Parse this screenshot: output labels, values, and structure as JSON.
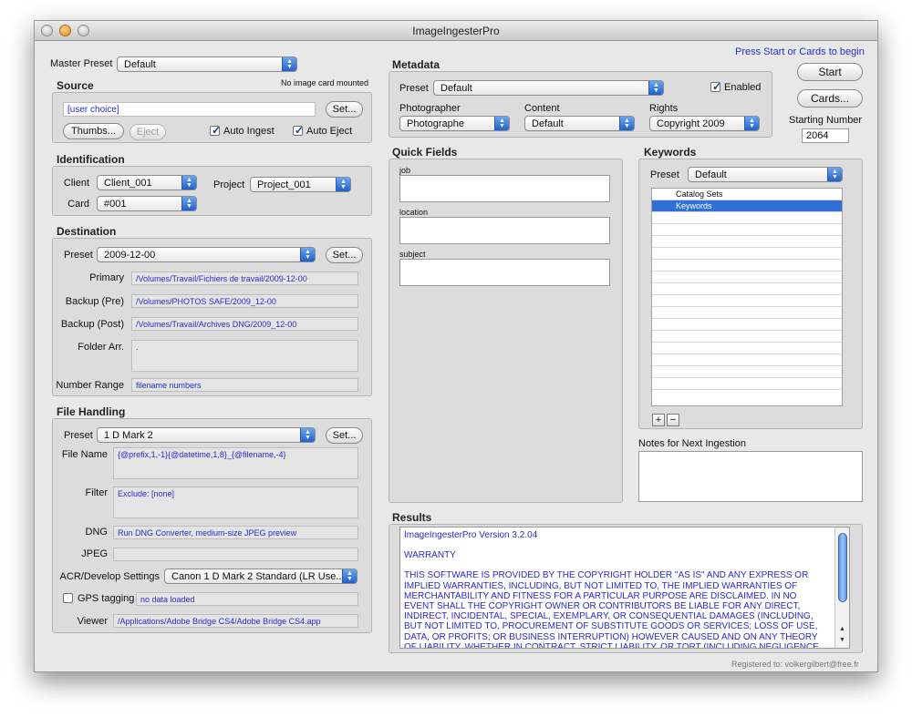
{
  "window": {
    "title": "ImageIngesterPro"
  },
  "master_preset": {
    "label": "Master Preset",
    "value": "Default"
  },
  "source": {
    "title": "Source",
    "status": "No image card mounted",
    "path": "[user choice]",
    "set_label": "Set...",
    "thumbs_label": "Thumbs...",
    "eject_label": "Eject",
    "auto_ingest": {
      "label": "Auto Ingest",
      "checked": true
    },
    "auto_eject": {
      "label": "Auto Eject",
      "checked": true
    }
  },
  "identification": {
    "title": "Identification",
    "client_label": "Client",
    "client_value": "Client_001",
    "project_label": "Project",
    "project_value": "Project_001",
    "card_label": "Card",
    "card_value": "#001"
  },
  "destination": {
    "title": "Destination",
    "preset_label": "Preset",
    "preset_value": "2009-12-00",
    "set_label": "Set...",
    "primary_label": "Primary",
    "primary_value": "/Volumes/Travail/Fichiers de travail/2009-12-00",
    "backup_pre_label": "Backup (Pre)",
    "backup_pre_value": "/Volumes/PHOTOS SAFE/2009_12-00",
    "backup_post_label": "Backup (Post)",
    "backup_post_value": "/Volumes/Travail/Archives DNG/2009_12-00",
    "folder_arr_label": "Folder Arr.",
    "folder_arr_value": ".",
    "number_range_label": "Number Range",
    "number_range_value": "filename numbers"
  },
  "file_handling": {
    "title": "File Handling",
    "preset_label": "Preset",
    "preset_value": "1 D Mark 2",
    "set_label": "Set...",
    "file_name_label": "File Name",
    "file_name_value": "{@prefix,1,-1}{@datetime,1,8}_{@filename,-4}",
    "filter_label": "Filter",
    "filter_value": "Exclude: [none]",
    "dng_label": "DNG",
    "dng_value": "Run DNG Converter, medium-size JPEG preview",
    "jpeg_label": "JPEG",
    "jpeg_value": "",
    "acr_label": "ACR/Develop Settings",
    "acr_value": "Canon 1 D Mark 2 Standard (LR Use...",
    "gps_label": "GPS tagging",
    "gps_checked": false,
    "gps_value": "no data loaded",
    "viewer_label": "Viewer",
    "viewer_value": "/Applications/Adobe Bridge CS4/Adobe Bridge CS4.app"
  },
  "prompt": "Press Start or Cards to begin",
  "metadata": {
    "title": "Metadata",
    "preset_label": "Preset",
    "preset_value": "Default",
    "enabled": {
      "label": "Enabled",
      "checked": true
    },
    "photographer_label": "Photographer",
    "photographer_value": "Photographe",
    "content_label": "Content",
    "content_value": "Default",
    "rights_label": "Rights",
    "rights_value": "Copyright 2009"
  },
  "controls": {
    "start_label": "Start",
    "cards_label": "Cards...",
    "starting_number_label": "Starting Number",
    "starting_number_value": "2064"
  },
  "quick_fields": {
    "title": "Quick Fields",
    "job_label": "job",
    "location_label": "location",
    "subject_label": "subject"
  },
  "keywords": {
    "title": "Keywords",
    "preset_label": "Preset",
    "preset_value": "Default",
    "items": [
      {
        "label": "Catalog Sets",
        "selected": false
      },
      {
        "label": "Keywords",
        "selected": true
      }
    ],
    "add_label": "+",
    "remove_label": "−"
  },
  "notes": {
    "label": "Notes for Next Ingestion"
  },
  "results": {
    "title": "Results",
    "version": "ImageIngesterPro Version 3.2.04",
    "warranty": "WARRANTY",
    "body": "THIS SOFTWARE IS PROVIDED BY THE COPYRIGHT HOLDER \"AS IS\" AND ANY EXPRESS OR IMPLIED WARRANTIES, INCLUDING, BUT NOT LIMITED TO, THE IMPLIED WARRANTIES OF MERCHANTABILITY AND FITNESS FOR A PARTICULAR PURPOSE ARE DISCLAIMED. IN NO EVENT SHALL THE COPYRIGHT OWNER OR CONTRIBUTORS BE LIABLE FOR ANY DIRECT, INDIRECT, INCIDENTAL, SPECIAL, EXEMPLARY, OR CONSEQUENTIAL DAMAGES (INCLUDING, BUT NOT LIMITED TO, PROCUREMENT OF SUBSTITUTE GOODS OR SERVICES; LOSS OF USE, DATA, OR PROFITS; OR BUSINESS INTERRUPTION) HOWEVER CAUSED AND ON ANY THEORY OF LIABILITY, WHETHER IN CONTRACT, STRICT LIABILITY, OR TORT (INCLUDING NEGLIGENCE OR OTHERWISE) ARISING IN ANY WAY OUT OF THE USE OF THIS SOFTWARE, EVEN IF"
  },
  "footer": {
    "registered": "Registered to: volkergilbert@free.fr"
  },
  "colors": {
    "accent": "#2f6fd6",
    "value_text": "#2a2ad0",
    "panel": "#dcdcdc"
  }
}
